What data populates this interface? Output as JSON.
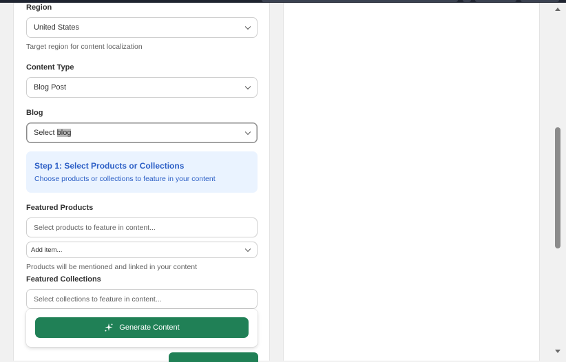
{
  "form": {
    "region": {
      "label": "Region",
      "value": "United States",
      "helper": "Target region for content localization"
    },
    "content_type": {
      "label": "Content Type",
      "value": "Blog Post"
    },
    "blog": {
      "label": "Blog",
      "value_prefix": "Select ",
      "value_highlight": "blog"
    },
    "step1": {
      "title": "Step 1: Select Products or Collections",
      "description": "Choose products or collections to feature in your content"
    },
    "featured_products": {
      "label": "Featured Products",
      "placeholder": "Select products to feature in content...",
      "add_item": "Add item...",
      "helper": "Products will be mentioned and linked in your content"
    },
    "featured_collections": {
      "label": "Featured Collections",
      "placeholder": "Select collections to feature in content..."
    },
    "generate_button": "Generate Content"
  },
  "icons": {
    "chevron": "chevron-down-icon",
    "sparkle": "sparkle-icon",
    "scroll_up": "scroll-up-arrow",
    "scroll_down": "scroll-down-arrow"
  },
  "colors": {
    "primary": "#208056",
    "info_bg": "#eaf3ff",
    "info_text": "#2c5fc6"
  }
}
